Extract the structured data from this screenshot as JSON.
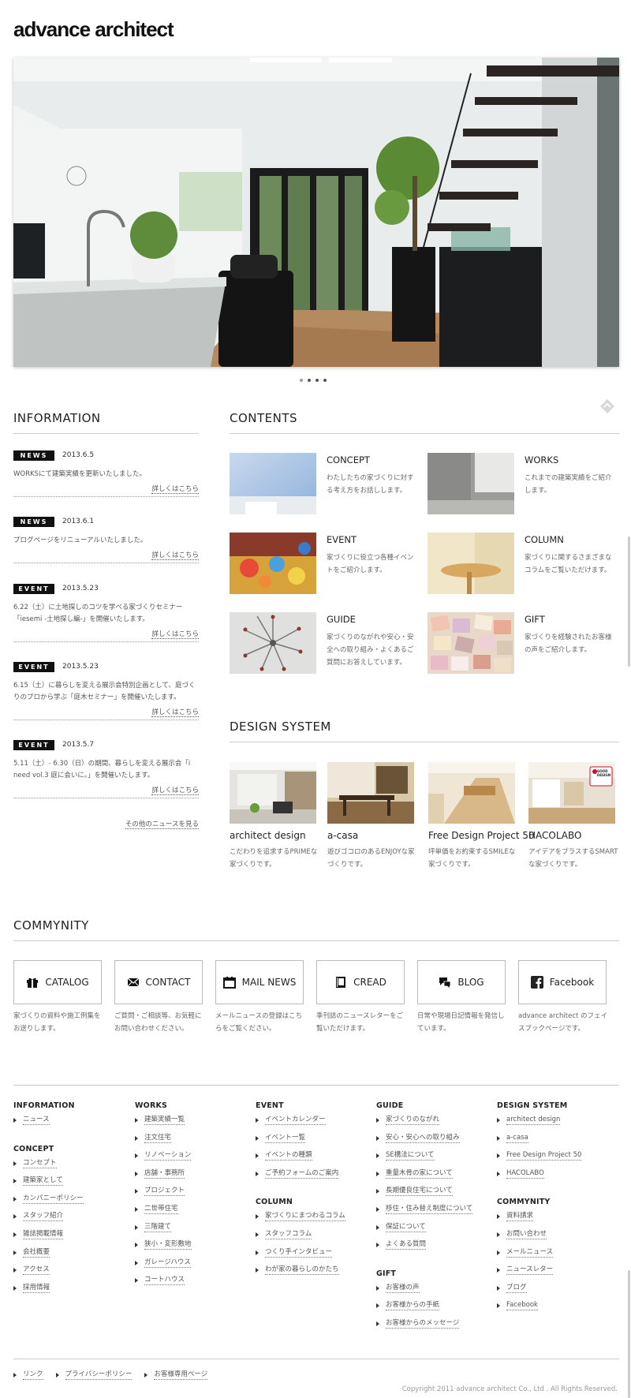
{
  "header": {
    "logo": "advance architect"
  },
  "slider": {
    "dot_count": 4
  },
  "information": {
    "title": "INFORMATION",
    "items": [
      {
        "tag": "NEWS",
        "date": "2013.6.5",
        "text": "WORKSにて建築実績を更新いたしました。",
        "more": "詳しくはこちら"
      },
      {
        "tag": "NEWS",
        "date": "2013.6.1",
        "text": "ブログページをリニューアルいたしました。",
        "more": "詳しくはこちら"
      },
      {
        "tag": "EVENT",
        "date": "2013.5.23",
        "text": "6.22（土）に土地探しのコツを学べる家づくりセミナー「iesemi -土地探し編-」を開催いたします。",
        "more": "詳しくはこちら"
      },
      {
        "tag": "EVENT",
        "date": "2013.5.23",
        "text": "6.15（土）に暮らしを変える展示会特別企画として、庭づくりのプロから学ぶ「庭木セミナー」を開催いたします。",
        "more": "詳しくはこちら"
      },
      {
        "tag": "EVENT",
        "date": "2013.5.7",
        "text": "5.11（土）- 6.30（日）の期間、暮らしを変える展示会「i need vol.3 庭に会いに。」を開催いたします。",
        "more": "詳しくはこちら"
      }
    ],
    "more_news": "その他のニュースを見る"
  },
  "contents": {
    "title": "CONTENTS",
    "items": [
      {
        "title": "CONCEPT",
        "desc": "わたしたちの家づくりに対する考え方をお話しします。"
      },
      {
        "title": "WORKS",
        "desc": "これまでの建築実績をご紹介します。"
      },
      {
        "title": "EVENT",
        "desc": "家づくりに役立つ各種イベントをご紹介します。"
      },
      {
        "title": "COLUMN",
        "desc": "家づくりに関するさまざまなコラムをご覧いただけます。"
      },
      {
        "title": "GUIDE",
        "desc": "家づくりのながれや安心・安全への取り組み・よくあるご質問にお答えしています。"
      },
      {
        "title": "GIFT",
        "desc": "家づくりを経験されたお客様の声をご紹介します。"
      }
    ]
  },
  "design_system": {
    "title": "DESIGN SYSTEM",
    "items": [
      {
        "title": "architect design",
        "desc": "こだわりを追求するPRIMEな家づくりです。"
      },
      {
        "title": "a-casa",
        "desc": "遊びゴコロのあるENJOYな家づくりです。"
      },
      {
        "title": "Free Design Project 50",
        "desc": "坪単価をお約束するSMILEな家づくりです。"
      },
      {
        "title": "HACOLABO",
        "desc": "アイデアをプラスするSMARTな家づくりです。"
      }
    ],
    "badge_line1": "GOOD",
    "badge_line2": "DESIGN"
  },
  "community": {
    "title": "COMMYNITY",
    "items": [
      {
        "label": "CATALOG",
        "icon": "gift-icon",
        "desc": "家づくりの資料や施工例集をお送りします。"
      },
      {
        "label": "CONTACT",
        "icon": "envelope-icon",
        "desc": "ご質問・ご相談等、お気軽にお問い合わせください。"
      },
      {
        "label": "MAIL NEWS",
        "icon": "calendar-icon",
        "desc": "メールニュースの登録はこちらをご覧ください。"
      },
      {
        "label": "CREAD",
        "icon": "book-icon",
        "desc": "季刊誌のニュースレターをご覧いただけます。"
      },
      {
        "label": "BLOG",
        "icon": "speech-bubble-icon",
        "desc": "日常や現場日記情報を発信しています。"
      },
      {
        "label": "Facebook",
        "icon": "facebook-icon",
        "desc": "advance architect のフェイスブックページです。"
      }
    ]
  },
  "footer": {
    "columns": [
      {
        "groups": [
          {
            "head": "INFORMATION",
            "items": [
              "ニュース"
            ]
          },
          {
            "head": "CONCEPT",
            "items": [
              "コンセプト",
              "建築家として",
              "カンパニーポリシー",
              "スタッフ紹介",
              "雑誌掲載情報",
              "会社概要",
              "アクセス",
              "採用情報"
            ]
          }
        ]
      },
      {
        "groups": [
          {
            "head": "WORKS",
            "items": [
              "建築実績一覧",
              "注文住宅",
              "リノベーション",
              "店舗・事務所",
              "プロジェクト",
              "二世帯住宅",
              "三階建て",
              "狭小・変形敷地",
              "ガレージハウス",
              "コートハウス"
            ]
          }
        ]
      },
      {
        "groups": [
          {
            "head": "EVENT",
            "items": [
              "イベントカレンダー",
              "イベント一覧",
              "イベントの種類",
              "ご予約フォームのご案内"
            ]
          },
          {
            "head": "COLUMN",
            "items": [
              "家づくりにまつわるコラム",
              "スタッフコラム",
              "つくり手インタビュー",
              "わが家の暮らしのかたち"
            ]
          }
        ]
      },
      {
        "groups": [
          {
            "head": "GUIDE",
            "items": [
              "家づくりのながれ",
              "安心・安心への取り組み",
              "SE構法について",
              "重量木骨の家について",
              "長期優良住宅について",
              "移住・住み替え制度について",
              "保証について",
              "よくある質問"
            ]
          },
          {
            "head": "GIFT",
            "items": [
              "お客様の声",
              "お客様からの手紙",
              "お客様からのメッセージ"
            ]
          }
        ]
      },
      {
        "groups": [
          {
            "head": "DESIGN SYSTEM",
            "items": [
              "architect design",
              "a-casa",
              "Free Design Project 50",
              "HACOLABO"
            ]
          },
          {
            "head": "COMMYNITY",
            "items": [
              "資料請求",
              "お問い合わせ",
              "メールニュース",
              "ニュースレター",
              "ブログ",
              "Facebook"
            ]
          }
        ]
      }
    ],
    "bottom_links": [
      "リンク",
      "プライバシーポリシー",
      "お客様専用ページ"
    ],
    "copyright": "Copyright 2011 advance architect Co., Ltd . All Rights Reserved."
  }
}
